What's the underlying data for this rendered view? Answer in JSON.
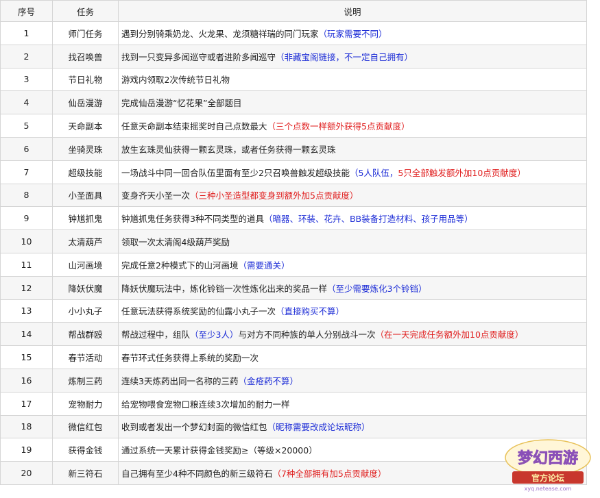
{
  "header": {
    "col_num": "序号",
    "col_task": "任务",
    "col_desc": "说明"
  },
  "rows": [
    {
      "num": "1",
      "task": "师门任务",
      "desc": "遇到分别骑乘奶龙、火龙果、龙须糖祥瑞的同门玩家",
      "note": "（玩家需要不同）",
      "note_color": "blue"
    },
    {
      "num": "2",
      "task": "找召唤兽",
      "desc": "找到一只变异多闻巡守或者进阶多闻巡守",
      "note": "（非藏宝阁链接，不一定自己拥有）",
      "note_color": "blue"
    },
    {
      "num": "3",
      "task": "节日礼物",
      "desc": "游戏内领取2次传统节日礼物",
      "note": "",
      "note_color": ""
    },
    {
      "num": "4",
      "task": "仙岳漫游",
      "desc": "完成仙岳漫游“忆花果”全部题目",
      "note": "",
      "note_color": ""
    },
    {
      "num": "5",
      "task": "天命副本",
      "desc": "任意天命副本结束摇奖时自己点数最大",
      "note": "（三个点数一样额外获得5点贡献度）",
      "note_color": "red"
    },
    {
      "num": "6",
      "task": "坐骑灵珠",
      "desc": "放生玄珠灵仙获得一颗玄灵珠，或者任务获得一颗玄灵珠",
      "note": "",
      "note_color": ""
    },
    {
      "num": "7",
      "task": "超级技能",
      "desc": "一场战斗中同一回合队伍里面有至少2只召唤兽触发超级技能",
      "note": "（5人队伍，",
      "note_color": "blue",
      "note2": "5只全部触发额外加10点贡献度）",
      "note2_color": "red"
    },
    {
      "num": "8",
      "task": "小圣面具",
      "desc": "变身齐天小圣一次",
      "note": "（三种小圣造型都变身到额外加5点贡献度）",
      "note_color": "red"
    },
    {
      "num": "9",
      "task": "钟馗抓鬼",
      "desc": "钟馗抓鬼任务获得3种不同类型的道具",
      "note": "（暗器、环装、花卉、BB装备打造材料、孩子用品等）",
      "note_color": "blue"
    },
    {
      "num": "10",
      "task": "太清葫芦",
      "desc": "领取一次太清阁4级葫芦奖励",
      "note": "",
      "note_color": ""
    },
    {
      "num": "11",
      "task": "山河画境",
      "desc": "完成任意2种模式下的山河画境",
      "note": "（需要通关）",
      "note_color": "blue"
    },
    {
      "num": "12",
      "task": "降妖伏魔",
      "desc": "降妖伏魔玩法中，炼化铃铛一次性炼化出来的奖品一样",
      "note": "（至少需要炼化3个铃铛）",
      "note_color": "blue"
    },
    {
      "num": "13",
      "task": "小小丸子",
      "desc": "任意玩法获得系统奖励的仙露小丸子一次",
      "note": "（直接购买不算）",
      "note_color": "blue"
    },
    {
      "num": "14",
      "task": "帮战群殴",
      "desc": "帮战过程中，组队",
      "note": "（至少3人）",
      "note_color": "blue",
      "desc2": "与对方不同种族的单人分别战斗一次",
      "note2": "（在一天完成任务额外加10点贡献度）",
      "note2_color": "red"
    },
    {
      "num": "15",
      "task": "春节活动",
      "desc": "春节环式任务获得上系统的奖励一次",
      "note": "",
      "note_color": ""
    },
    {
      "num": "16",
      "task": "炼制三药",
      "desc": "连续3天炼药出同一名称的三药",
      "note": "（金疮药不算）",
      "note_color": "blue"
    },
    {
      "num": "17",
      "task": "宠物耐力",
      "desc": "给宠物喂食宠物口粮连续3次增加的耐力一样",
      "note": "",
      "note_color": ""
    },
    {
      "num": "18",
      "task": "微信红包",
      "desc": "收到或者发出一个梦幻封面的微信红包",
      "note": "（昵称需要改成论坛昵称）",
      "note_color": "blue"
    },
    {
      "num": "19",
      "task": "获得金钱",
      "desc": "通过系统一天累计获得金钱奖励≥（等级×20000）",
      "note": "",
      "note_color": ""
    },
    {
      "num": "20",
      "task": "新三符石",
      "desc": "自己拥有至少4种不同颜色的新三级符石",
      "note": "（7种全部拥有加5点贡献度）",
      "note_color": "red"
    }
  ],
  "watermark": {
    "line1": "梦幻西游",
    "line2": "官方论坛",
    "line3": "xyq.netease.com",
    "colors": {
      "gold": "#e8a21a",
      "purple": "#8a4fb8",
      "red": "#c8372d"
    }
  }
}
